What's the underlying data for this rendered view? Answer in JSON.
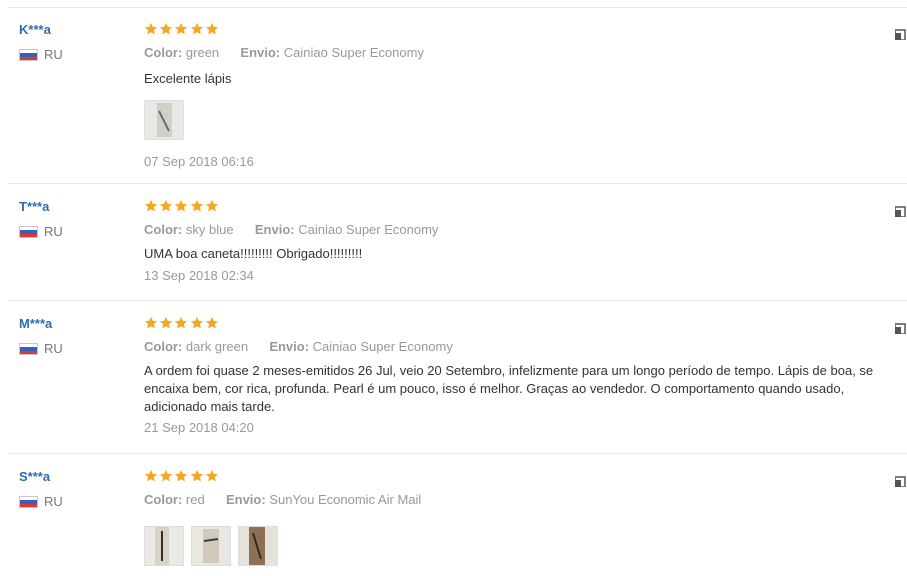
{
  "labels": {
    "color_key": "Color:",
    "shipping_key": "Envio:"
  },
  "reviews": [
    {
      "user": "K***a",
      "country": "RU",
      "stars": 5,
      "color": "green",
      "shipping": "Cainiao Super Economy",
      "text": "Excelente lápis",
      "photos": 1,
      "date": "07 Sep 2018 06:16"
    },
    {
      "user": "T***a",
      "country": "RU",
      "stars": 5,
      "color": "sky blue",
      "shipping": "Cainiao Super Economy",
      "text": "UMA boa caneta!!!!!!!!! Obrigado!!!!!!!!!",
      "photos": 0,
      "date": "13 Sep 2018 02:34"
    },
    {
      "user": "M***a",
      "country": "RU",
      "stars": 5,
      "color": "dark green",
      "shipping": "Cainiao Super Economy",
      "text": "A ordem foi quase 2 meses-emitidos 26 Jul, veio 20 Setembro, infelizmente para um longo período de tempo. Lápis de boa, se encaixa bem, cor rica, profunda. Pearl é um pouco, isso é melhor. Graças ao vendedor. O comportamento quando usado, adicionado mais tarde.",
      "photos": 0,
      "date": "21 Sep 2018 04:20"
    },
    {
      "user": "S***a",
      "country": "RU",
      "stars": 5,
      "color": "red",
      "shipping": "SunYou Economic Air Mail",
      "text": "",
      "photos": 3,
      "date": ""
    }
  ],
  "colors": {
    "username": "#2d6bb5",
    "star": "#f5a623",
    "muted": "#999999",
    "divider": "#e8e8e8"
  },
  "icons": {
    "star": "star-icon",
    "flag": "russia-flag-icon",
    "vote": "thumb-vote-icon"
  }
}
